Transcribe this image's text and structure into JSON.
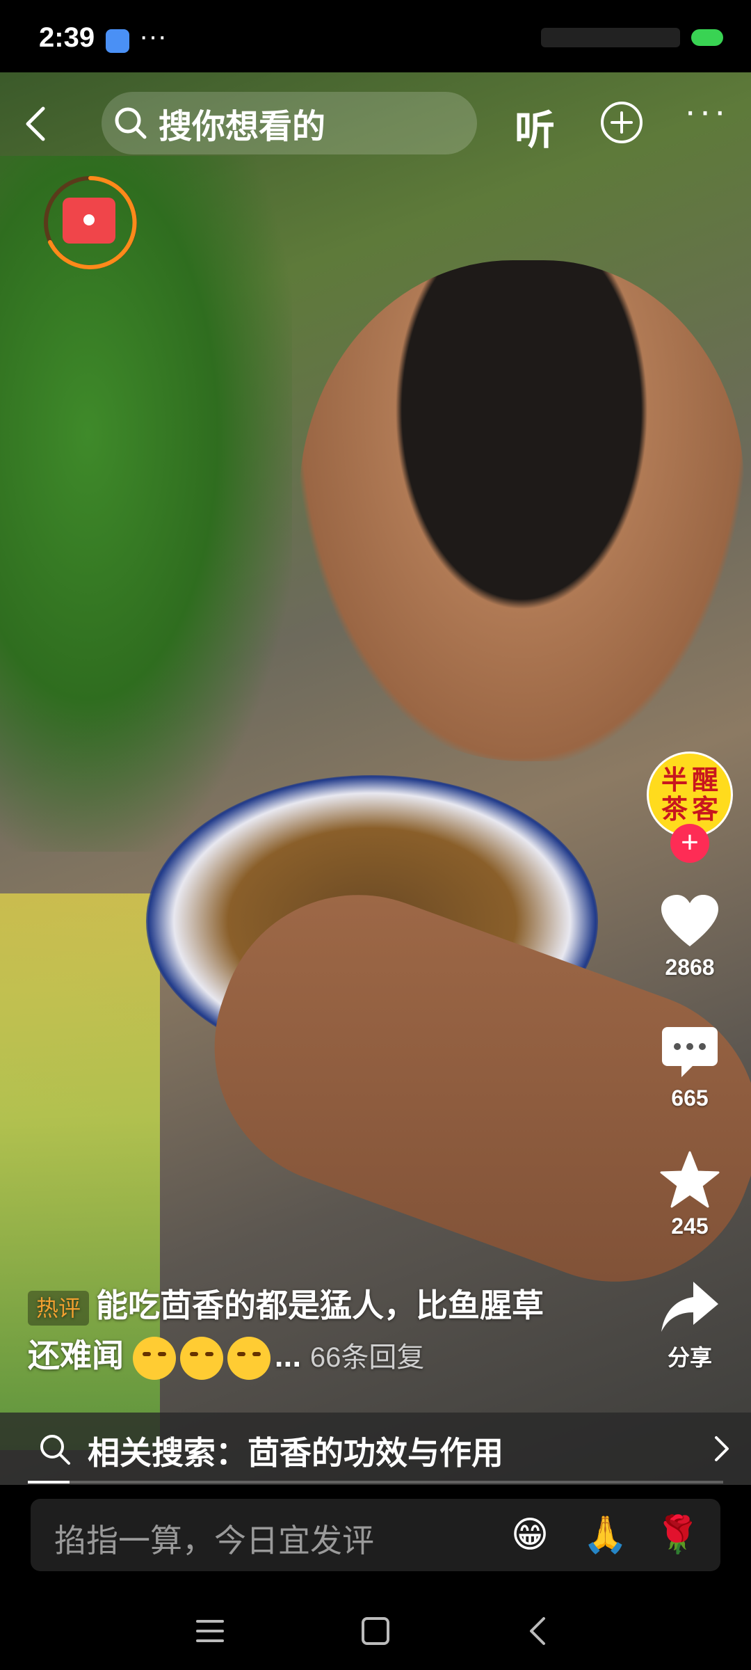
{
  "status": {
    "time": "2:39",
    "dots": "···"
  },
  "top_bar": {
    "search_text": "搜你想看的",
    "listen_label": "听",
    "more_label": "···"
  },
  "rail": {
    "avatar_text": [
      "半",
      "醒",
      "茶",
      "客"
    ],
    "follow_label": "+",
    "likes": "2868",
    "comments": "665",
    "favorites": "245",
    "share_label": "分享"
  },
  "hot_comment": {
    "tag": "热评",
    "text_line1": "能吃茴香的都是猛人，比鱼腥草",
    "text_line2": "还难闻",
    "emojis": [
      "crying-face",
      "crying-face",
      "crying-face"
    ],
    "ellipsis": "...",
    "replies": "66条回复"
  },
  "related_search": {
    "text": "相关搜索：茴香的功效与作用"
  },
  "video_progress": 0.06,
  "comment_bar": {
    "placeholder": "掐指一算，今日宜发评",
    "emoji_buttons": [
      "😁",
      "🙏",
      "🌹"
    ]
  },
  "colors": {
    "accent_red": "#fe2c55",
    "hot_tag": "#f0a030",
    "avatar_bg": "#ffdb1d",
    "red_packet_ring": "#ff8a1a"
  }
}
